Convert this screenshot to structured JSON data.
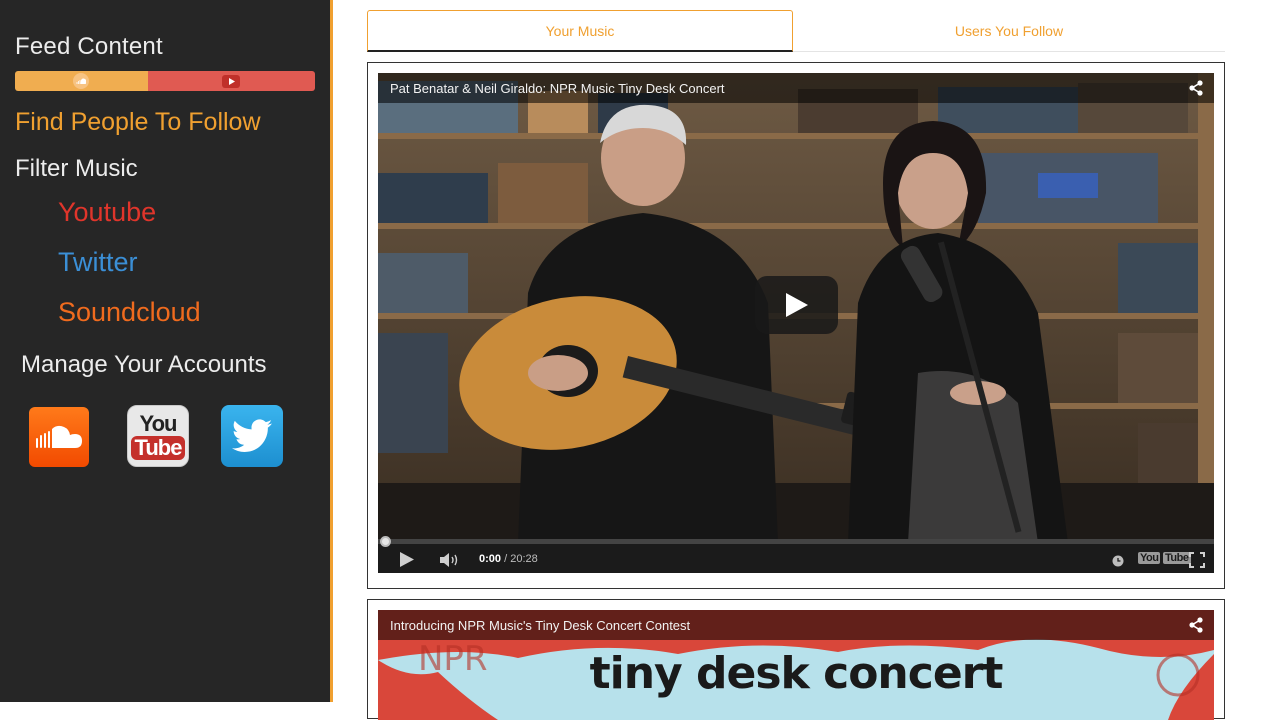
{
  "sidebar": {
    "feed_title": "Feed Content",
    "feed_bar": {
      "soundcloud_share": 0.443,
      "youtube_share": 0.557,
      "soundcloud_color": "#f0ad50",
      "youtube_color": "#e05a52"
    },
    "find_people": "Find People To Follow",
    "filter_title": "Filter Music",
    "filters": [
      {
        "label": "Youtube",
        "color": "#e0352b"
      },
      {
        "label": "Twitter",
        "color": "#3b8fd6"
      },
      {
        "label": "Soundcloud",
        "color": "#f06b1e"
      }
    ],
    "manage_title": "Manage Your Accounts",
    "accounts": [
      {
        "icon": "soundcloud-icon"
      },
      {
        "icon": "youtube-icon",
        "you": "You",
        "tube": "Tube"
      },
      {
        "icon": "twitter-icon"
      }
    ],
    "accent": "#f0a030"
  },
  "tabs": [
    {
      "label": "Your Music",
      "active": true
    },
    {
      "label": "Users You Follow",
      "active": false
    }
  ],
  "videos": [
    {
      "title": "Pat Benatar & Neil Giraldo: NPR Music Tiny Desk Concert",
      "current_time": "0:00",
      "duration": "20:28",
      "progress": 0,
      "logo": {
        "you": "You",
        "tube": "Tube"
      }
    },
    {
      "title": "Introducing NPR Music's Tiny Desk Concert Contest",
      "banner": "tiny desk concert"
    }
  ]
}
